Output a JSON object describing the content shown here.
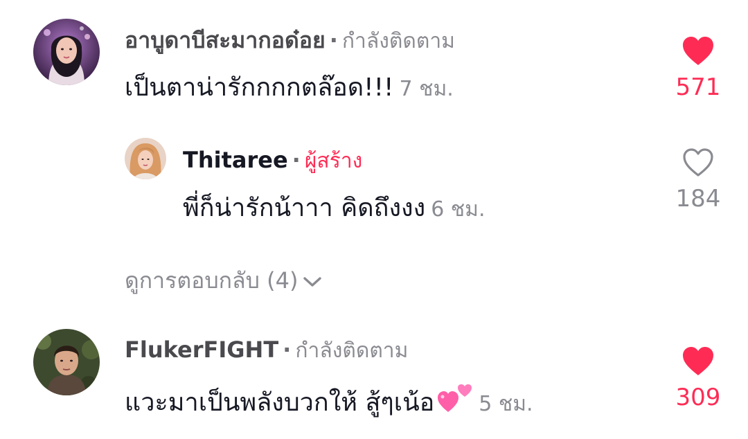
{
  "comments": [
    {
      "username": "อาบูดาบีสะมากอด๋อย",
      "separator": "·",
      "tag": "กำลังติดตาม",
      "text": "เป็นตาน่ารักกกกตล๊อด!!!",
      "time": "7 ชม.",
      "likes": "571",
      "liked": true
    },
    {
      "username": "Thitaree",
      "separator": "·",
      "tag": "ผู้สร้าง",
      "text": "พี่ก็น่ารักน้าาา คิดถึงงง",
      "time": "6 ชม.",
      "likes": "184",
      "liked": false
    },
    {
      "username": "FlukerFIGHT",
      "separator": "·",
      "tag": "กำลังติดตาม",
      "text": "แวะมาเป็นพลังบวกให้ สู้ๆเน้อ",
      "time": "5 ชม.",
      "likes": "309",
      "liked": true
    }
  ],
  "view_replies": "ดูการตอบกลับ (4)",
  "icons": {
    "like_filled": "heart-filled-icon",
    "like_outline": "heart-outline-icon",
    "expand": "chevron-down-icon",
    "emoji": "two-hearts-emoji"
  },
  "colors": {
    "accent": "#fe2c55",
    "muted": "#8a8b91",
    "text": "#161823"
  }
}
